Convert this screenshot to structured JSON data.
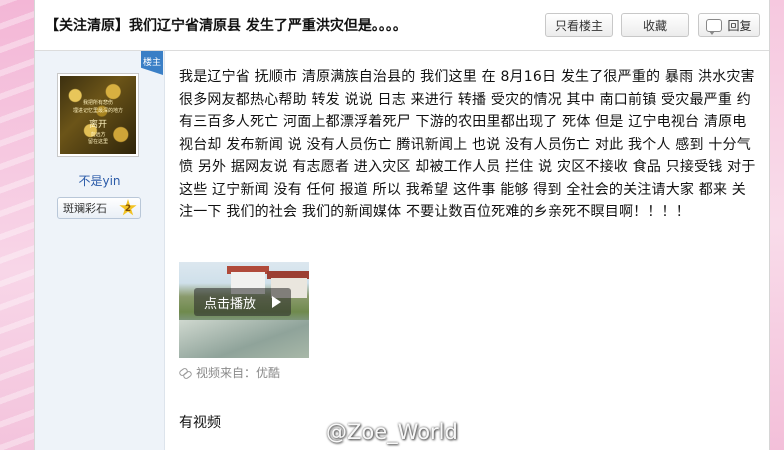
{
  "header": {
    "title": "【关注清原】我们辽宁省清原县 发生了严重洪灾但是。。。。",
    "buttons": {
      "only_op": "只看楼主",
      "favorite": "收藏",
      "reply": "回复"
    }
  },
  "author": {
    "avatar_text": [
      "我把所有悲伤",
      "埋进记忆里最深的地方",
      "离开",
      "向远方",
      "留在这里"
    ],
    "username": "不是yin",
    "medal": {
      "name": "斑斓彩石",
      "level": "2"
    },
    "role_tag": "楼主"
  },
  "post": {
    "body": "我是辽宁省 抚顺市 清原满族自治县的 我们这里 在 8月16日 发生了很严重的 暴雨 洪水灾害很多网友都热心帮助 转发 说说 日志 来进行 转播 受灾的情况 其中 南口前镇 受灾最严重 约有三百多人死亡 河面上都漂浮着死尸 下游的农田里都出现了 死体 但是 辽宁电视台 清原电视台却 发布新闻 说 没有人员伤亡 腾讯新闻上 也说 没有人员伤亡 对此 我个人 感到 十分气愤 另外 据网友说 有志愿者 进入灾区 却被工作人员 拦住 说 灾区不接收 食品 只接受钱 对于 这些 辽宁新闻 没有 任何 报道 所以 我希望 这件事 能够 得到 全社会的关注请大家 都来 关注一下 我们的社会 我们的新闻媒体 不要让数百位死难的乡亲死不瞑目啊！！！！",
    "video": {
      "play_label": "点击播放",
      "source": "视频来自：优酷"
    },
    "after_text": "有视频"
  },
  "watermark": "@Zoe_World",
  "colors": {
    "accent": "#3a7fc6",
    "username": "#2a5aa8",
    "sidebar_bg": "#eef3f9"
  }
}
